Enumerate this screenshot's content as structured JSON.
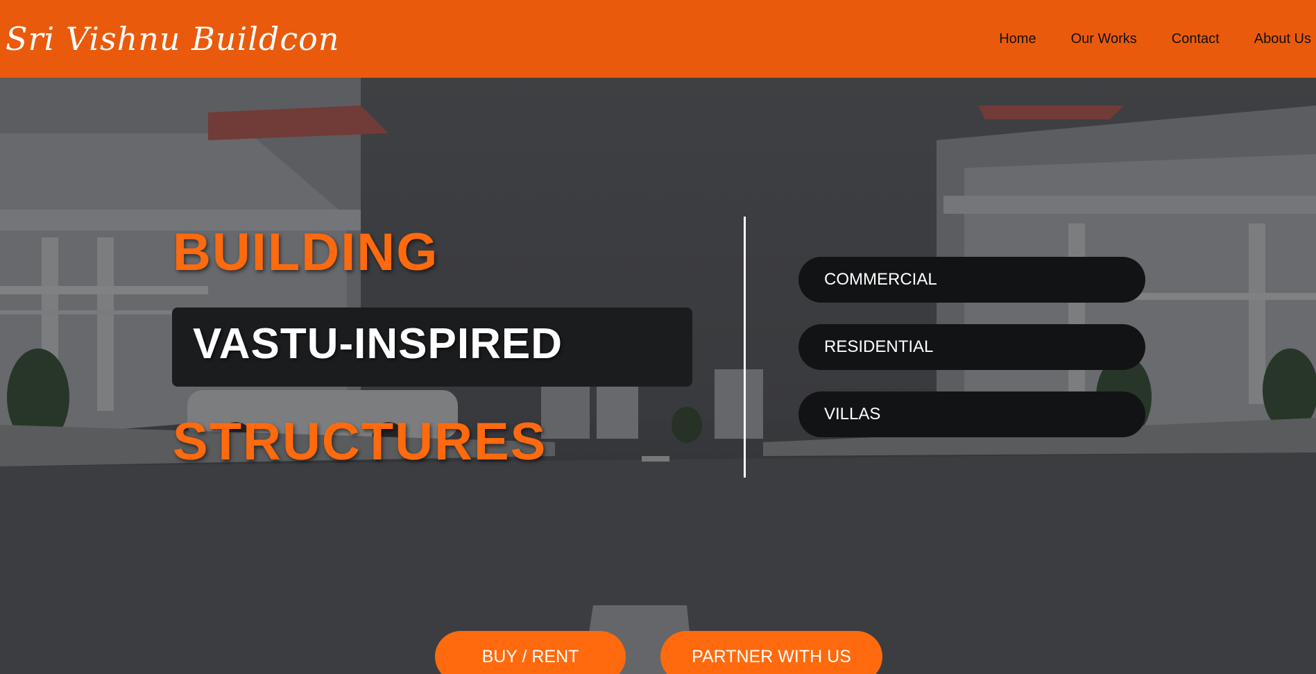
{
  "brand": {
    "logo_text": "Sri Vishnu Buildcon"
  },
  "nav": {
    "items": [
      "Home",
      "Our Works",
      "Contact",
      "About Us"
    ]
  },
  "hero": {
    "line1": "BUILDING",
    "line2": "VASTU-INSPIRED",
    "line3": "STRUCTURES",
    "categories": [
      "COMMERCIAL",
      "RESIDENTIAL",
      "VILLAS"
    ],
    "buttons": [
      "BUY / RENT",
      "PARTNER WITH US"
    ]
  },
  "colors": {
    "header": "#ea5a0c",
    "accent": "#ff6a0e",
    "dark_pill": "#121314",
    "text_light": "#ffffff"
  }
}
